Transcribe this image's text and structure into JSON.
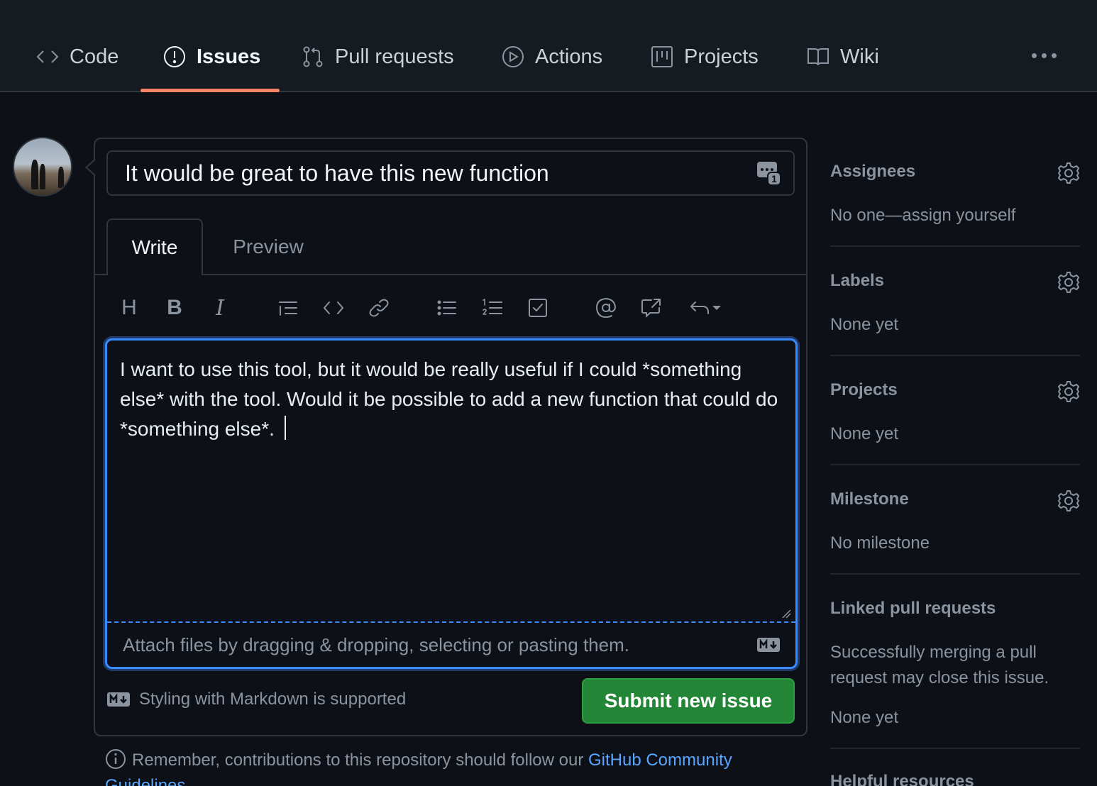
{
  "nav": {
    "tabs": [
      {
        "label": "Code",
        "icon": "code-icon"
      },
      {
        "label": "Issues",
        "icon": "issue-opened-icon"
      },
      {
        "label": "Pull requests",
        "icon": "git-pull-request-icon"
      },
      {
        "label": "Actions",
        "icon": "play-icon"
      },
      {
        "label": "Projects",
        "icon": "project-board-icon"
      },
      {
        "label": "Wiki",
        "icon": "book-icon"
      }
    ],
    "active_tab": "Issues"
  },
  "issue": {
    "title": "It would be great to have this new function",
    "title_badge_count": "1",
    "tabs": {
      "write": "Write",
      "preview": "Preview"
    },
    "body": "I want to use this tool, but it would be really useful if I could *something else* with the tool. Would it be possible to add a new function that could do *something else*.",
    "attach_hint": "Attach files by dragging & dropping, selecting or pasting them.",
    "markdown_hint": "Styling with Markdown is supported",
    "submit_label": "Submit new issue",
    "remember_text": "Remember, contributions to this repository should follow our ",
    "remember_link": "GitHub Community Guidelines",
    "remember_end": "."
  },
  "toolbar": {
    "items": [
      "heading-icon",
      "bold-icon",
      "italic-icon",
      "quote-icon",
      "code-icon",
      "link-icon",
      "unordered-list-icon",
      "ordered-list-icon",
      "tasklist-icon",
      "mention-icon",
      "cross-reference-icon",
      "reply-icon"
    ],
    "heading_glyph": "H",
    "bold_glyph": "B",
    "italic_glyph": "I"
  },
  "sidebar": {
    "assignees": {
      "title": "Assignees",
      "value": "No one—assign yourself"
    },
    "labels": {
      "title": "Labels",
      "value": "None yet"
    },
    "projects": {
      "title": "Projects",
      "value": "None yet"
    },
    "milestone": {
      "title": "Milestone",
      "value": "No milestone"
    },
    "linked_prs": {
      "title": "Linked pull requests",
      "description": "Successfully merging a pull request may close this issue.",
      "value": "None yet"
    },
    "helpful": {
      "title": "Helpful resources"
    }
  },
  "colors": {
    "background": "#0d1117",
    "accent_underline": "#f78166",
    "focus_border": "#388bfd",
    "submit_green": "#238636",
    "link_blue": "#58a6ff"
  }
}
